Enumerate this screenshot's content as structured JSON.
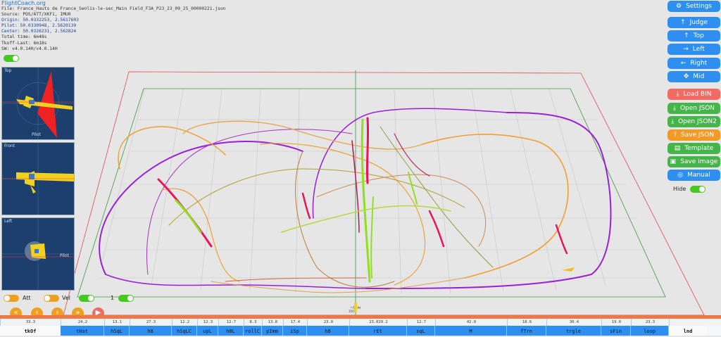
{
  "info": {
    "brand": "FlightCoach.org",
    "file": "File: France_Hauts de France_Senlis-le-sec_Main Field_F3A_P23_23_09_25_00000221.json",
    "source": "Source: POS/ATT/XKF1, IMU0",
    "origin": "Origin: 50.0332253, 2.5617603",
    "pilot": "Pilot: 50.0330948, 2.5620139",
    "center": "Center: 50.0326231, 2.562824",
    "total_time": "Total time: 6m48s",
    "tkoff_last": "Tkoff-Last: 6m18s",
    "sw": "SW: v4.0.14H/v4.0.14H"
  },
  "views": [
    {
      "label": "Top",
      "pilot_label": "Pilot"
    },
    {
      "label": "Front",
      "pilot_label": ""
    },
    {
      "label": "Left",
      "pilot_label": "Pilot"
    }
  ],
  "legend": {
    "att": "Att",
    "vel": "Vel",
    "count": "1"
  },
  "nav_icons": [
    "double-chevron-left-icon",
    "chevron-left-icon",
    "chevron-right-icon",
    "double-chevron-right-icon",
    "play-icon"
  ],
  "buttons": [
    {
      "label": "Settings",
      "icon": "gear-icon",
      "glyph": "⚙",
      "color": "#2f8ff0"
    },
    {
      "label": "Judge",
      "icon": "arrow-up-icon",
      "glyph": "↑",
      "color": "#2f8ff0"
    },
    {
      "label": "Top",
      "icon": "arrow-up-icon",
      "glyph": "↑",
      "color": "#2f8ff0"
    },
    {
      "label": "Left",
      "icon": "arrow-right-icon",
      "glyph": "→",
      "color": "#2f8ff0"
    },
    {
      "label": "Right",
      "icon": "arrow-left-icon",
      "glyph": "←",
      "color": "#2f8ff0"
    },
    {
      "label": "Mid",
      "icon": "move-icon",
      "glyph": "✥",
      "color": "#2f8ff0"
    },
    {
      "label": "Load BIN",
      "icon": "download-icon",
      "glyph": "⤓",
      "color": "#f26b63"
    },
    {
      "label": "Open JSON",
      "icon": "download-icon",
      "glyph": "⤓",
      "color": "#46b44a"
    },
    {
      "label": "Open JSON2",
      "icon": "download-icon",
      "glyph": "⤓",
      "color": "#46b44a"
    },
    {
      "label": "Save JSON",
      "icon": "upload-icon",
      "glyph": "⤒",
      "color": "#f29a28"
    },
    {
      "label": "Template",
      "icon": "document-icon",
      "glyph": "▤",
      "color": "#46b44a"
    },
    {
      "label": "Save Image",
      "icon": "image-icon",
      "glyph": "▣",
      "color": "#46b44a"
    },
    {
      "label": "Manual",
      "icon": "help-icon",
      "glyph": "◎",
      "color": "#2f8ff0"
    }
  ],
  "hide_label": "Hide",
  "scene": {
    "distance_label": "~97m",
    "distance_sub": "150m"
  },
  "timeline": {
    "segments": [
      {
        "name": "tkOf",
        "score": "33.3",
        "active": false
      },
      {
        "name": "tHat",
        "score": "24.2",
        "active": true
      },
      {
        "name": "hSqL",
        "score": "13.1",
        "active": true
      },
      {
        "name": "h8",
        "score": "27.3",
        "active": true
      },
      {
        "name": "hSqLC",
        "score": "12.2",
        "active": true
      },
      {
        "name": "upL",
        "score": "12.3",
        "active": true
      },
      {
        "name": "h8L",
        "score": "12.7",
        "active": true
      },
      {
        "name": "rollC",
        "score": "8.3",
        "active": true
      },
      {
        "name": "pImm",
        "score": "13.8",
        "active": true
      },
      {
        "name": "iSp",
        "score": "17.4",
        "active": true
      },
      {
        "name": "h8",
        "score": "23.0",
        "active": true
      },
      {
        "name": "rEt",
        "score": "23.029.2",
        "active": true
      },
      {
        "name": "sqL",
        "score": "12.7",
        "active": true
      },
      {
        "name": "M",
        "score": "42.0",
        "active": true
      },
      {
        "name": "fTrn",
        "score": "18.6",
        "active": true
      },
      {
        "name": "trgle",
        "score": "30.4",
        "active": true
      },
      {
        "name": "sFin",
        "score": "19.0",
        "active": true
      },
      {
        "name": "loop",
        "score": "23.3",
        "active": true
      },
      {
        "name": "lnd",
        "score": "",
        "active": false
      }
    ]
  },
  "colors": {
    "accent": "#2f8ff0",
    "purple": "#9a1fd6",
    "orange": "#f0a030",
    "green": "#8fe020",
    "magenta": "#e8155a"
  }
}
